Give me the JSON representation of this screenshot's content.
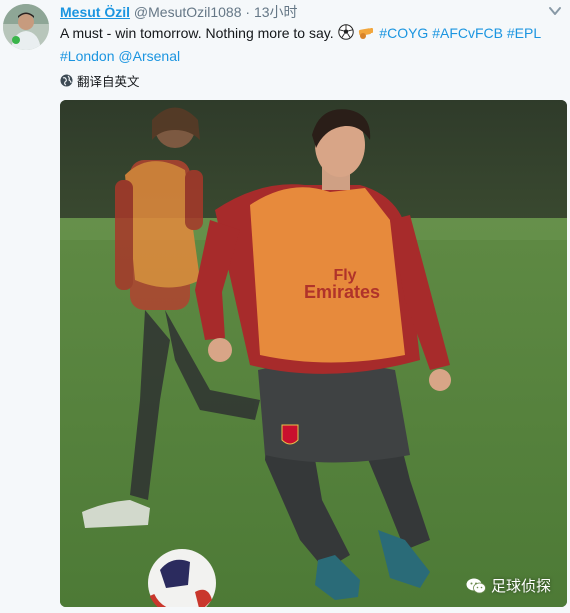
{
  "tweet": {
    "display_name": "Mesut Özil",
    "handle": "@MesutOzil1088",
    "separator": "·",
    "time": "13小时",
    "text_main": "A must - win tomorrow. Nothing more to say. ",
    "hashtags_line1": [
      "#COYG",
      "#AFCvFCB",
      "#EPL"
    ],
    "hashtag_line2": "#London",
    "mention": "@Arsenal",
    "translate_label": "翻译自英文"
  },
  "colors": {
    "link": "#1b95e0",
    "background": "#f5f8fa",
    "text": "#14171a",
    "muted": "#657786"
  },
  "photo": {
    "shirt_text_line1": "Fly",
    "shirt_text_line2": "Emirates"
  },
  "watermark": {
    "label": "足球侦探"
  }
}
